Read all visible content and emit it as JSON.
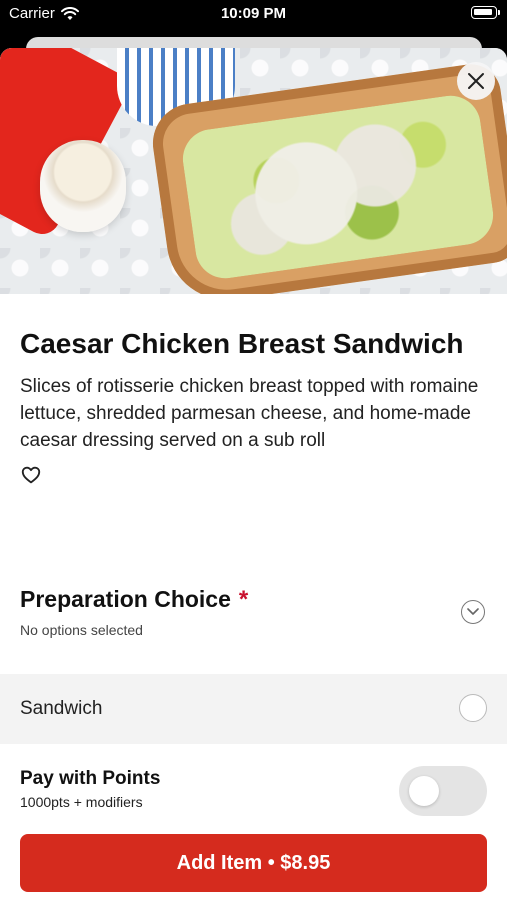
{
  "status_bar": {
    "carrier": "Carrier",
    "time": "10:09 PM",
    "icons": [
      "wifi-icon",
      "battery-icon"
    ]
  },
  "item": {
    "title": "Caesar Chicken Breast Sandwich",
    "description": "Slices of rotisserie chicken breast topped with romaine lettuce, shredded parmesan cheese, and home-made caesar dressing served on a sub roll",
    "image_icon": "sandwich-photo",
    "favorite_icon": "heart-icon",
    "close_icon": "close-icon"
  },
  "preparation": {
    "title": "Preparation Choice",
    "required_mark": "*",
    "status": "No options selected",
    "chevron_icon": "chevron-down-icon",
    "options": [
      {
        "label": "Sandwich",
        "selected": false
      }
    ]
  },
  "points": {
    "title": "Pay with Points",
    "subtitle": "1000pts + modifiers",
    "enabled": false
  },
  "cta": {
    "label": "Add Item • $8.95"
  },
  "colors": {
    "accent": "#d52b1e",
    "required": "#c8102e",
    "option_bg": "#f3f3f3",
    "toggle_off": "#e4e4e4"
  }
}
